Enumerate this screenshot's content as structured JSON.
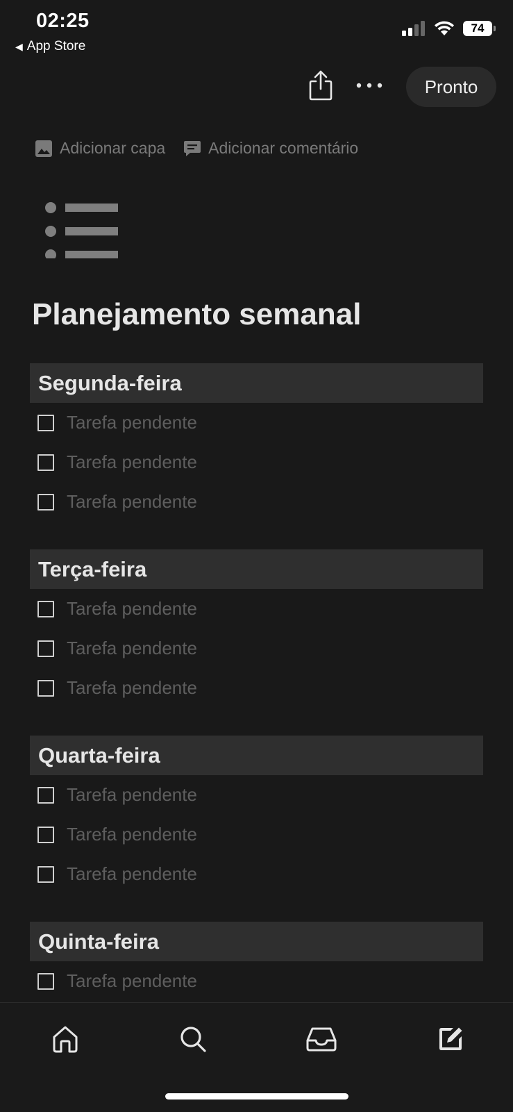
{
  "status_bar": {
    "time": "02:25",
    "back_app": "App Store",
    "battery": "74"
  },
  "toolbar": {
    "done_label": "Pronto",
    "share_icon": "share-icon",
    "more_icon": "more-icon"
  },
  "page_actions": {
    "add_cover": "Adicionar capa",
    "add_comment": "Adicionar comentário"
  },
  "page": {
    "icon": "bulleted-list-icon",
    "title": "Planejamento semanal"
  },
  "sections": [
    {
      "heading": "Segunda-feira",
      "tasks": [
        "Tarefa pendente",
        "Tarefa pendente",
        "Tarefa pendente"
      ]
    },
    {
      "heading": "Terça-feira",
      "tasks": [
        "Tarefa pendente",
        "Tarefa pendente",
        "Tarefa pendente"
      ]
    },
    {
      "heading": "Quarta-feira",
      "tasks": [
        "Tarefa pendente",
        "Tarefa pendente",
        "Tarefa pendente"
      ]
    },
    {
      "heading": "Quinta-feira",
      "tasks": [
        "Tarefa pendente"
      ]
    }
  ],
  "bottom_nav": [
    "home-icon",
    "search-icon",
    "inbox-icon",
    "new-page-icon"
  ],
  "colors": {
    "background": "#191919",
    "heading_bg": "#2f2f2f",
    "placeholder_text": "#5e5e5e"
  }
}
